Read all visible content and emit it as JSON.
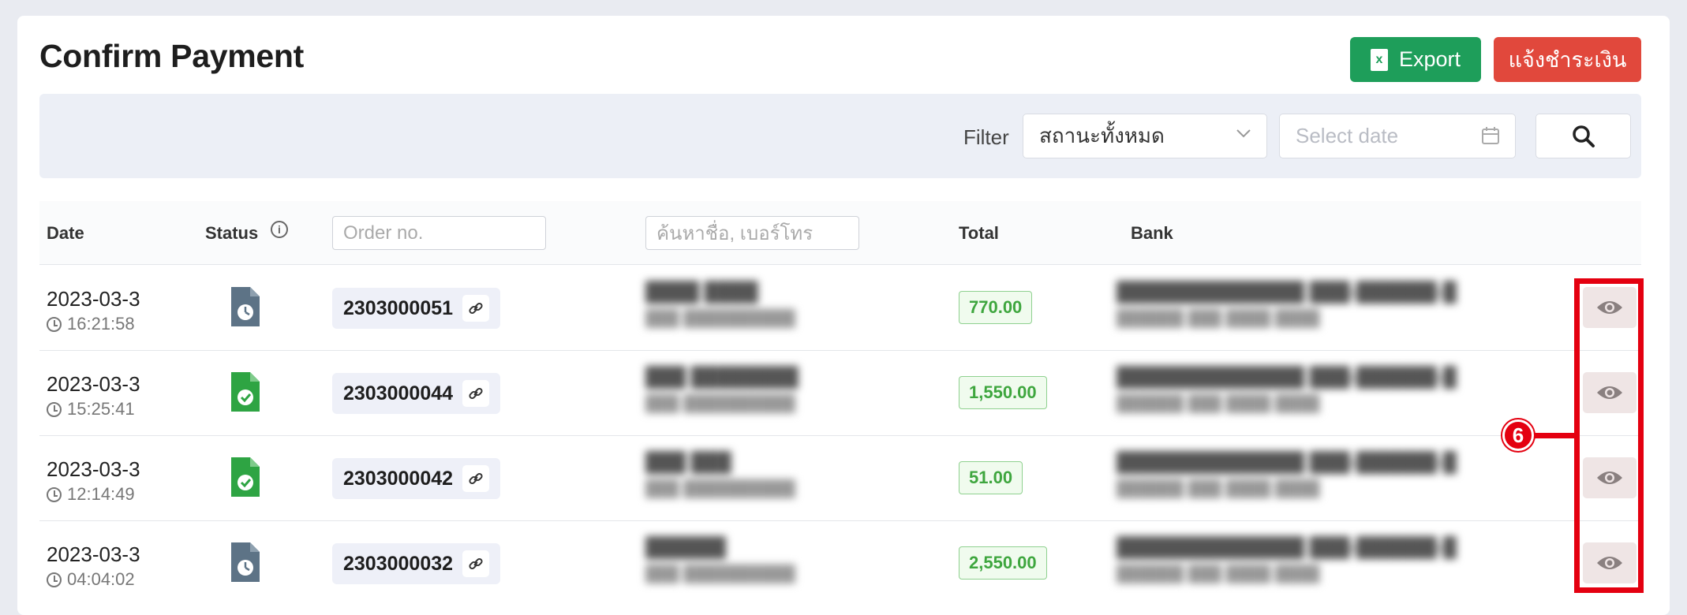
{
  "page": {
    "title": "Confirm Payment",
    "export_label": "Export",
    "notify_label": "แจ้งชำระเงิน",
    "colors": {
      "export": "#1e9e5a",
      "notify": "#e1483c",
      "highlight": "#e40010",
      "total_text": "#3ea63e"
    }
  },
  "filter": {
    "label": "Filter",
    "status_value": "สถานะทั้งหมด",
    "date_placeholder": "Select date"
  },
  "table": {
    "headers": {
      "date": "Date",
      "status": "Status",
      "order_placeholder": "Order no.",
      "customer_placeholder": "ค้นหาชื่อ, เบอร์โทร",
      "total": "Total",
      "bank": "Bank"
    },
    "rows": [
      {
        "date": "2023-03-3",
        "time": "16:21:58",
        "status": "pending",
        "order": "2303000051",
        "total": "770.00"
      },
      {
        "date": "2023-03-3",
        "time": "15:25:41",
        "status": "confirmed",
        "order": "2303000044",
        "total": "1,550.00"
      },
      {
        "date": "2023-03-3",
        "time": "12:14:49",
        "status": "confirmed",
        "order": "2303000042",
        "total": "51.00"
      },
      {
        "date": "2023-03-3",
        "time": "04:04:02",
        "status": "pending",
        "order": "2303000032",
        "total": "2,550.00"
      }
    ]
  },
  "annotation": {
    "badge": "6"
  }
}
